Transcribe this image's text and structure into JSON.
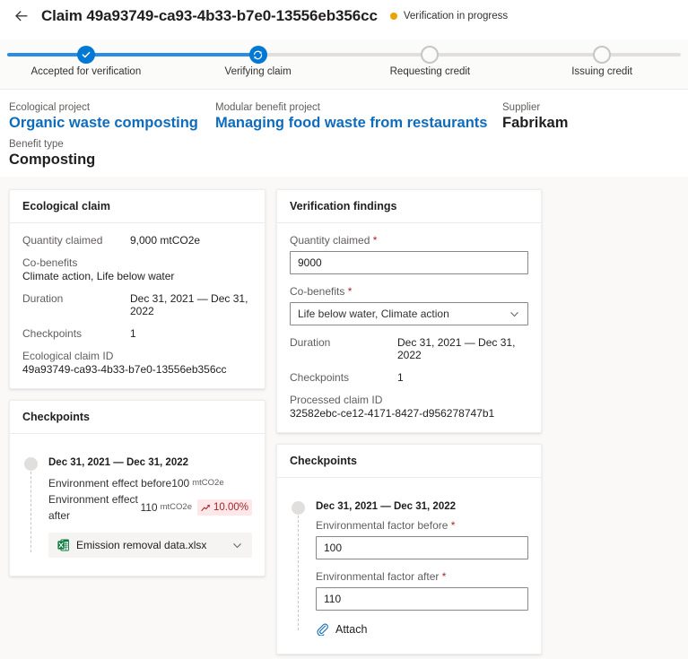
{
  "header": {
    "back_icon": "arrow-left-icon",
    "title": "Claim 49a93749-ca93-4b33-b7e0-13556eb356cc",
    "status_text": "Verification in progress",
    "status_color": "#eaa300"
  },
  "stepper": {
    "accent_color": "#0078d4",
    "steps": [
      {
        "label": "Accepted for verification",
        "state": "done",
        "icon": "check-icon"
      },
      {
        "label": "Verifying claim",
        "state": "current",
        "icon": "sync-icon"
      },
      {
        "label": "Requesting credit",
        "state": "todo",
        "icon": "circle-outline-icon"
      },
      {
        "label": "Issuing credit",
        "state": "todo",
        "icon": "circle-outline-icon"
      }
    ]
  },
  "summary": {
    "ecological_project_label": "Ecological project",
    "ecological_project_value": "Organic waste composting",
    "modular_benefit_label": "Modular benefit project",
    "modular_benefit_value": "Managing food waste from restaurants",
    "supplier_label": "Supplier",
    "supplier_value": "Fabrikam",
    "benefit_type_label": "Benefit type",
    "benefit_type_value": "Composting",
    "link_color": "#0f6cbd"
  },
  "ecological_claim": {
    "title": "Ecological claim",
    "quantity_label": "Quantity claimed",
    "quantity_value": "9,000 mtCO2e",
    "cobenefits_label": "Co-benefits",
    "cobenefits_value": "Climate action, Life below water",
    "duration_label": "Duration",
    "duration_value": "Dec 31, 2021 — Dec 31, 2022",
    "checkpoints_label": "Checkpoints",
    "checkpoints_value": "1",
    "claim_id_label": "Ecological claim ID",
    "claim_id_value": "49a93749-ca93-4b33-b7e0-13556eb356cc"
  },
  "left_checkpoints": {
    "title": "Checkpoints",
    "date_range": "Dec 31, 2021 — Dec 31, 2022",
    "before_label": "Environment effect before",
    "before_value": "100",
    "before_unit": "mtCO2e",
    "after_label": "Environment effect after",
    "after_value": "110",
    "after_unit": "mtCO2e",
    "trend_value": "10.00%",
    "trend_icon": "trend-up-icon",
    "trend_bg": "#fde7e9",
    "trend_fg": "#a4262c",
    "file_icon": "excel-file-icon",
    "file_name": "Emission removal data.xlsx",
    "file_chevron": "chevron-down-icon"
  },
  "verification_findings": {
    "title": "Verification findings",
    "quantity_label": "Quantity claimed",
    "quantity_required": "*",
    "quantity_value": "9000",
    "cobenefits_label": "Co-benefits",
    "cobenefits_required": "*",
    "cobenefits_value": "Life below water, Climate action",
    "cobenefits_chevron": "chevron-down-icon",
    "duration_label": "Duration",
    "duration_value": "Dec 31, 2021 — Dec 31, 2022",
    "checkpoints_label": "Checkpoints",
    "checkpoints_value": "1",
    "processed_id_label": "Processed claim ID",
    "processed_id_value": "32582ebc-ce12-4171-8427-d956278747b1"
  },
  "right_checkpoints": {
    "title": "Checkpoints",
    "date_range": "Dec 31, 2021 — Dec 31, 2022",
    "before_label": "Environmental factor before",
    "before_required": "*",
    "before_value": "100",
    "after_label": "Environmental factor after",
    "after_required": "*",
    "after_value": "110",
    "attach_icon": "paperclip-icon",
    "attach_label": "Attach"
  }
}
